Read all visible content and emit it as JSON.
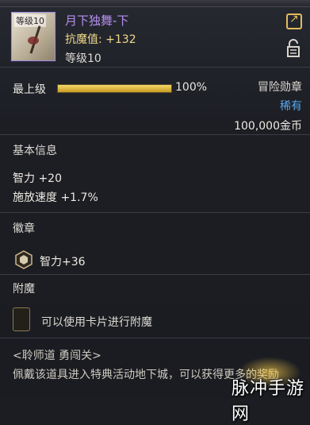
{
  "item": {
    "icon_tag": "等级10",
    "name": "月下独舞-下",
    "resist_label": "抗魔值:",
    "resist_value": "+132",
    "level": "等级10",
    "grade_label": "最上级",
    "grade_percent": "100%",
    "grade_fill": 1.0,
    "category": "冒险勋章",
    "rarity": "稀有",
    "price": "100,000金币"
  },
  "basic": {
    "title": "基本信息",
    "stats": [
      "智力 +20",
      "施放速度 +1.7%"
    ]
  },
  "emblem": {
    "title": "徽章",
    "text": "智力+36"
  },
  "enchant": {
    "title": "附魔",
    "text": "可以使用卡片进行附魔"
  },
  "description": {
    "line1": "<聆师道 勇闯关>",
    "line2": "佩戴该道具进入特典活动地下城，可以获得更多的奖励"
  },
  "watermark": "脉冲手游网",
  "colors": {
    "name": "#b78ff0",
    "rarity": "#58a8ef",
    "accent_gold": "#e2bb5c"
  }
}
